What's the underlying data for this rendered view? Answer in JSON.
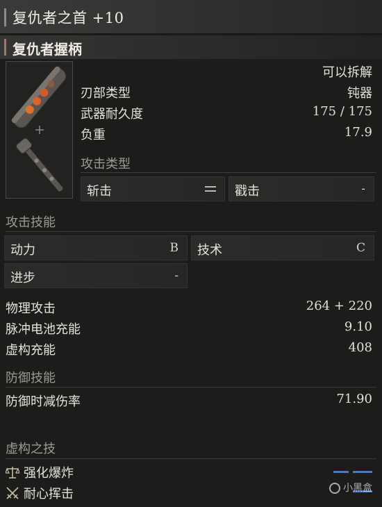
{
  "header": {
    "title": "复仇者之首 +10",
    "subtitle": "复仇者握柄"
  },
  "weapon": {
    "detachable": "可以拆解",
    "blade_type_label": "刃部类型",
    "blade_type_value": "钝器",
    "durability_label": "武器耐久度",
    "durability_value": "175 / 175",
    "weight_label": "负重",
    "weight_value": "17.9"
  },
  "attack_type": {
    "heading": "攻击类型",
    "slash_label": "斩击",
    "pierce_label": "戳击",
    "pierce_value": "-"
  },
  "attack_skill": {
    "heading": "攻击技能",
    "motivity_label": "动力",
    "motivity_value": "B",
    "technique_label": "技术",
    "technique_value": "C",
    "advance_label": "进步",
    "advance_value": "-"
  },
  "stats": {
    "physical_label": "物理攻击",
    "physical_value": "264 + 220",
    "cell_label": "脉冲电池充能",
    "cell_value": "9.10",
    "fable_label": "虚构充能",
    "fable_value": "408"
  },
  "defense": {
    "heading": "防御技能",
    "guard_label": "防御时减伤率",
    "guard_value": "71.90"
  },
  "fable_arts": {
    "heading": "虚构之技",
    "skill1": "强化爆炸",
    "skill2": "耐心挥击"
  },
  "watermark": "小黑盒",
  "icons": [
    "balance-scale-icon",
    "crossed-swords-icon",
    "equals-icon",
    "plus-icon"
  ]
}
